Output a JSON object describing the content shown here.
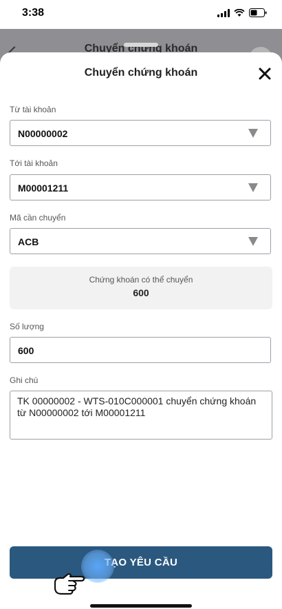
{
  "status_bar": {
    "time": "3:38"
  },
  "background_screen": {
    "title": "Chuyển chứng khoán"
  },
  "sheet": {
    "title": "Chuyển chứng khoán",
    "from_account": {
      "label": "Từ tài khoản",
      "value": "N00000002"
    },
    "to_account": {
      "label": "Tới tài khoản",
      "value": "M00001211"
    },
    "symbol": {
      "label": "Mã cần chuyển",
      "value": "ACB"
    },
    "available": {
      "label": "Chứng khoán có thể chuyển",
      "value": "600"
    },
    "quantity": {
      "label": "Số lượng",
      "value": "600"
    },
    "note": {
      "label": "Ghi chú",
      "value": "TK 00000002 - WTS-010C000001 chuyển chứng khoán từ N00000002 tới M00001211"
    },
    "submit_label": "TẠO YÊU CẦU"
  },
  "colors": {
    "primary": "#2b587f",
    "overlay": "#8e8e93"
  },
  "icons": [
    "close-icon",
    "dropdown-arrow-icon",
    "pointing-hand-icon",
    "signal-icon",
    "wifi-icon",
    "battery-icon"
  ]
}
